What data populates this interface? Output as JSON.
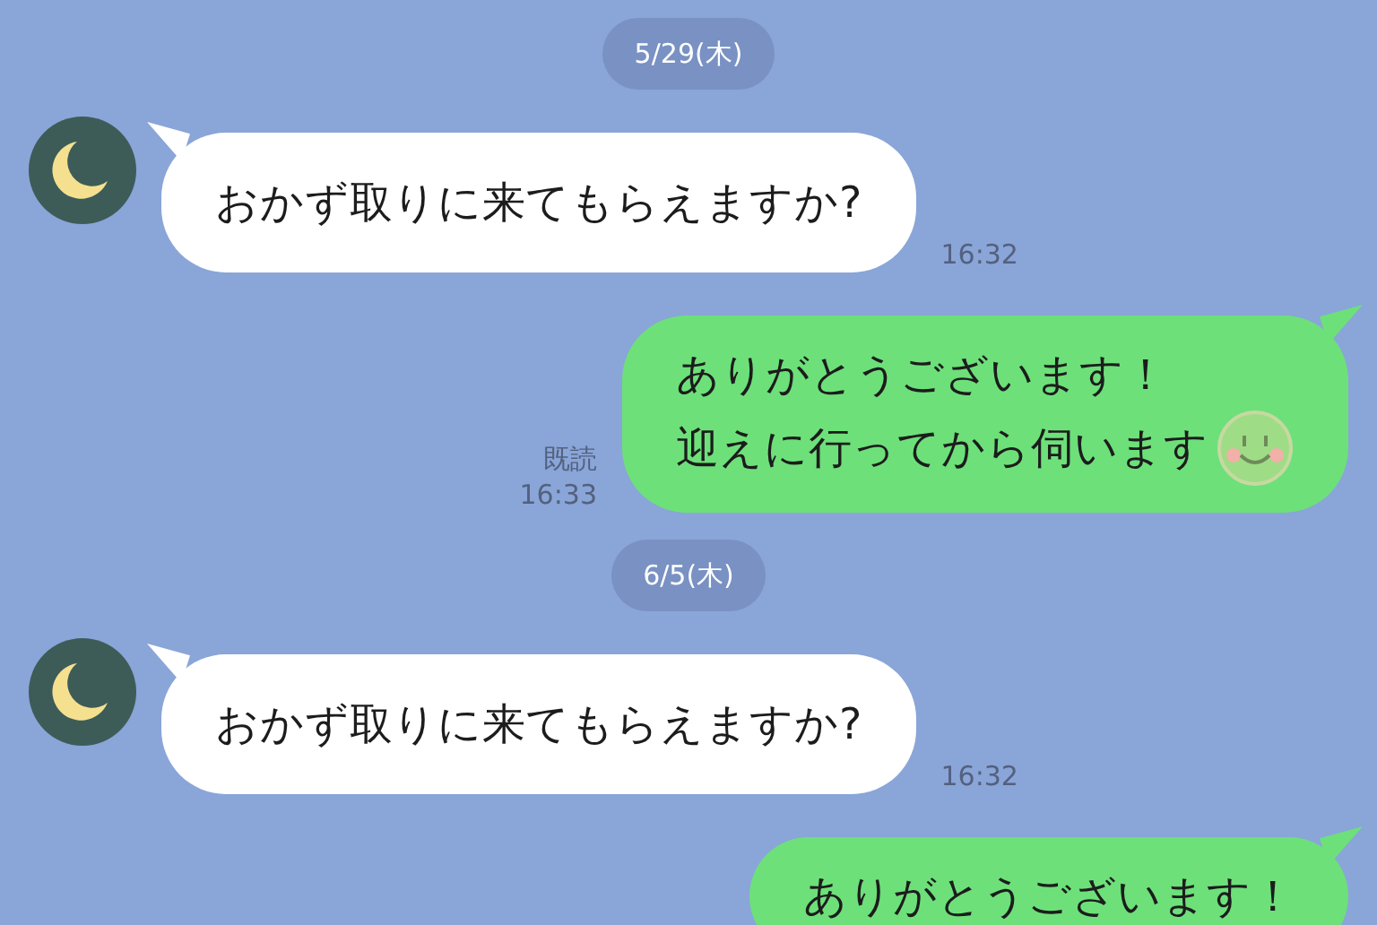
{
  "messages": [
    {
      "kind": "date",
      "text": "5/29(木)"
    },
    {
      "kind": "incoming",
      "lines": [
        "おかず取りに来てもらえますか?"
      ],
      "time": "16:32"
    },
    {
      "kind": "outgoing",
      "lines": [
        "ありがとうございます！",
        "迎えに行ってから伺います"
      ],
      "emoji": {
        "kind": "smiley"
      },
      "read": "既読",
      "time": "16:33"
    },
    {
      "kind": "date",
      "text": "6/5(木)"
    },
    {
      "kind": "incoming",
      "lines": [
        "おかず取りに来てもらえますか?"
      ],
      "time": "16:32"
    },
    {
      "kind": "outgoing",
      "lines": [
        "ありがとうございます！"
      ]
    }
  ]
}
